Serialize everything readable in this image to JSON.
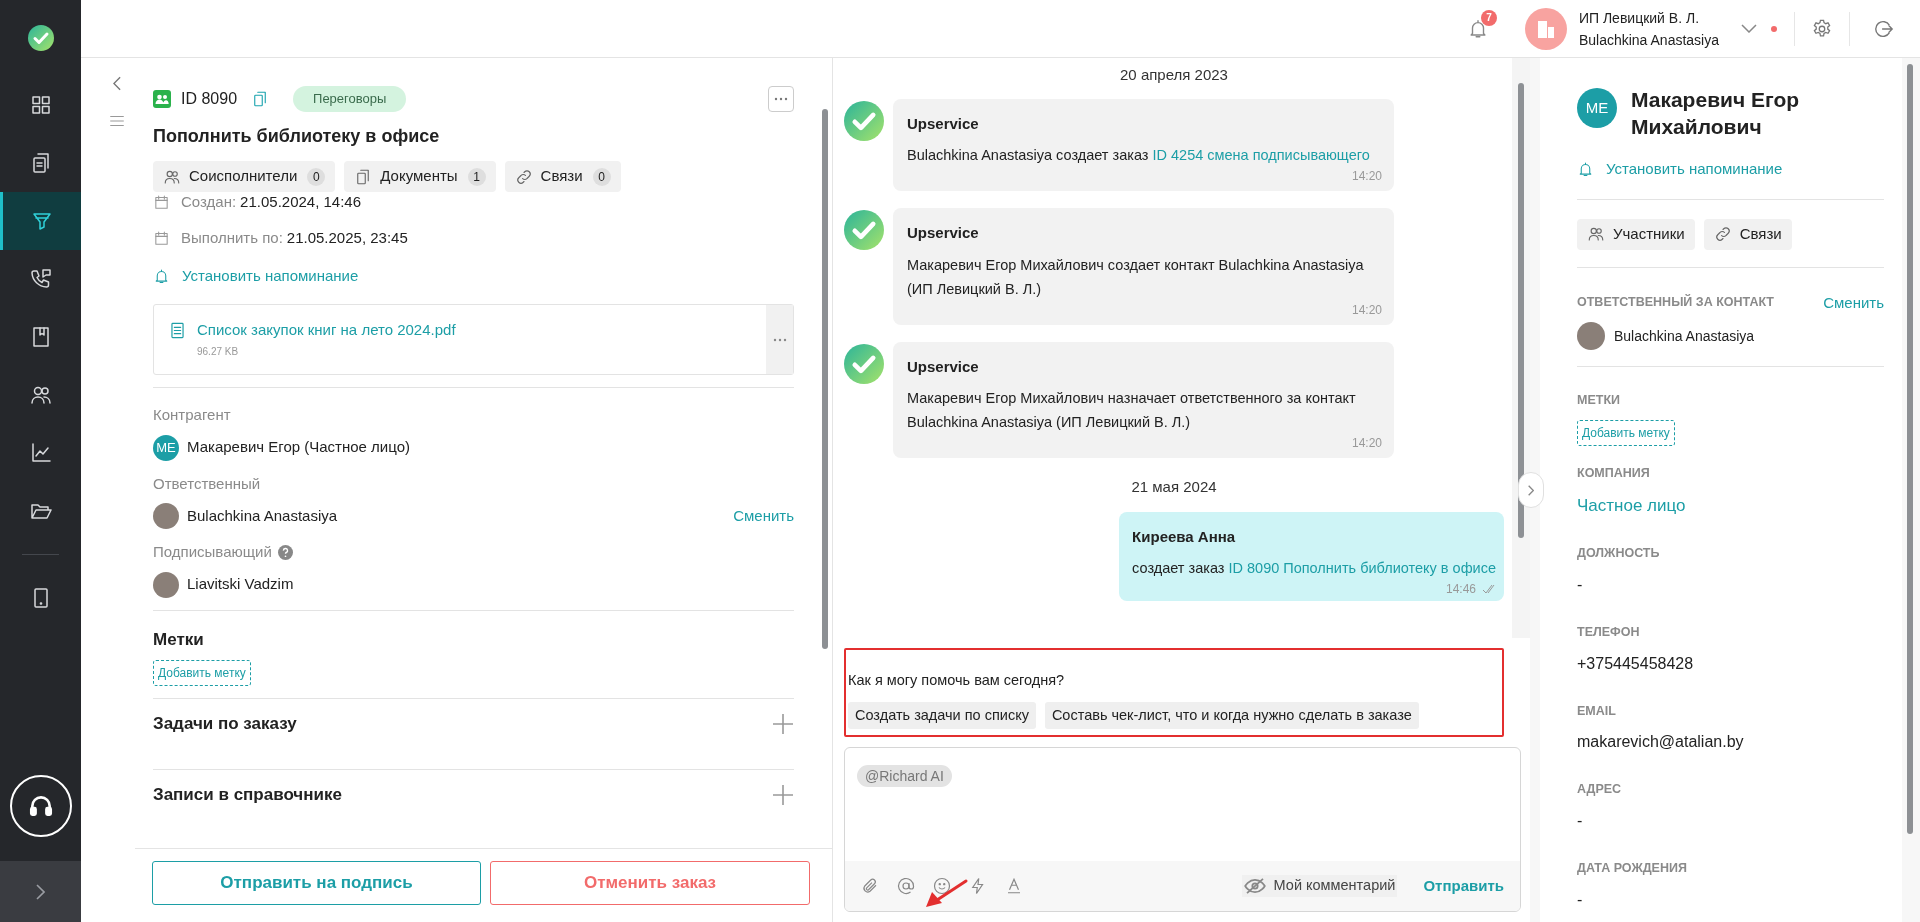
{
  "sidebar": {
    "items": [
      {
        "kind": "grid",
        "selected": false
      },
      {
        "kind": "clipboard",
        "selected": false
      },
      {
        "kind": "funnel",
        "selected": true
      },
      {
        "kind": "phone",
        "selected": false
      },
      {
        "kind": "book",
        "selected": false
      },
      {
        "kind": "people",
        "selected": false
      },
      {
        "kind": "chart",
        "selected": false
      },
      {
        "kind": "folder",
        "selected": false
      },
      {
        "kind": "tablet",
        "selected": false
      }
    ]
  },
  "topbar": {
    "notifications": "7",
    "company": "ИП Левицкий В. Л.",
    "user": "Bulachkina Anastasiya"
  },
  "order": {
    "id": "ID 8090",
    "status": "Переговоры",
    "title": "Пополнить библиотеку в офисе",
    "chips": [
      {
        "kind": "people",
        "label": "Соисполнители",
        "count": "0"
      },
      {
        "kind": "docs",
        "label": "Документы",
        "count": "1"
      },
      {
        "kind": "link",
        "label": "Связи",
        "count": "0"
      }
    ],
    "dates": [
      {
        "label": "Создан:",
        "value": "21.05.2024, 14:46"
      },
      {
        "label": "Выполнить по:",
        "value": "21.05.2025, 23:45"
      }
    ],
    "reminder": "Установить напоминание",
    "attachment": {
      "name": "Список закупок книг на лето 2024.pdf",
      "size": "96.27 KB"
    },
    "counterparty_label": "Контрагент",
    "counterparty": {
      "initials": "ME",
      "name": "Макаревич Егор (Частное лицо)"
    },
    "responsible_label": "Ответственный",
    "responsible": {
      "name": "Bulachkina Anastasiya",
      "action": "Сменить"
    },
    "signer_label": "Подписывающий",
    "signer": {
      "name": "Liavitski Vadzim"
    },
    "tags_title": "Метки",
    "add_tag": "Добавить метку",
    "sections": [
      "Задачи по заказу",
      "Записи в справочнике"
    ],
    "buttons": [
      {
        "kind": "primary",
        "label": "Отправить на подпись"
      },
      {
        "kind": "danger",
        "label": "Отменить заказ"
      }
    ]
  },
  "chat": {
    "items": [
      {
        "kind": "date",
        "text": "20 апреля 2023"
      },
      {
        "kind": "incoming",
        "author": "Upservice",
        "text": "Bulachkina Anastasiya создает заказ",
        "link": "ID 4254 смена подписывающего",
        "time": "14:20"
      },
      {
        "kind": "incoming",
        "author": "Upservice",
        "text": "Макаревич Егор Михайлович создает контакт Bulachkina Anastasiya (ИП Левицкий В. Л.)",
        "time": "14:20"
      },
      {
        "kind": "incoming",
        "author": "Upservice",
        "text": "Макаревич Егор Михайлович назначает ответственного за контакт Bulachkina Anastasiya (ИП Левицкий В. Л.)",
        "time": "14:20"
      },
      {
        "kind": "date",
        "text": "21 мая 2024"
      },
      {
        "kind": "outgoing",
        "author": "Киреева Анна",
        "text": "создает заказ",
        "link": "ID 8090 Пополнить библиотеку в офисе",
        "time": "14:46"
      }
    ],
    "assistant": {
      "prompt": "Как я могу помочь вам сегодня?",
      "suggestions": [
        "Создать задачи по списку",
        "Составь чек-лист, что и когда нужно сделать в заказе"
      ]
    },
    "compose": {
      "mention": "@Richard AI",
      "private_label": "Мой комментарий",
      "send": "Отправить"
    }
  },
  "contact": {
    "initials": "ME",
    "name": "Макаревич Егор Михайлович",
    "reminder": "Установить напоминание",
    "chips": [
      {
        "kind": "people",
        "label": "Участники"
      },
      {
        "kind": "link",
        "label": "Связи"
      }
    ],
    "responsible_label": "ОТВЕТСТВЕННЫЙ ЗА КОНТАКТ",
    "responsible_action": "Сменить",
    "responsible": "Bulachkina Anastasiya",
    "tags_label": "МЕТКИ",
    "add_tag": "Добавить метку",
    "fields": [
      {
        "kind": "link",
        "label": "КОМПАНИЯ",
        "value": "Частное лицо"
      },
      {
        "kind": "plain",
        "label": "ДОЛЖНОСТЬ",
        "value": "-"
      },
      {
        "kind": "plain",
        "label": "ТЕЛЕФОН",
        "value": "+375445458428"
      },
      {
        "kind": "plain",
        "label": "EMAIL",
        "value": "makarevich@atalian.by"
      },
      {
        "kind": "plain",
        "label": "АДРЕС",
        "value": "-"
      },
      {
        "kind": "plain",
        "label": "ДАТА РОЖДЕНИЯ",
        "value": "-"
      }
    ]
  }
}
